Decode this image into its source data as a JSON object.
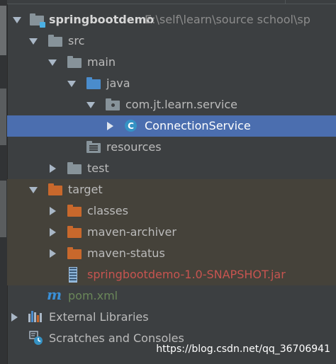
{
  "project": {
    "name": "springbootdemo",
    "path": "E:\\self\\learn\\source school\\sp"
  },
  "tree": {
    "src": "src",
    "main": "main",
    "java": "java",
    "package": "com.jt.learn.service",
    "class_file": "ConnectionService",
    "class_icon_letter": "C",
    "resources": "resources",
    "test": "test",
    "target": "target",
    "classes": "classes",
    "maven_archiver": "maven-archiver",
    "maven_status": "maven-status",
    "jar": "springbootdemo-1.0-SNAPSHOT.jar",
    "pom": "pom.xml",
    "pom_icon_letter": "m",
    "external_libraries": "External Libraries",
    "scratches": "Scratches and Consoles"
  },
  "watermark": "https://blog.csdn.net/qq_36706941",
  "colors": {
    "background": "#3c3f41",
    "selected_row": "#4b6eaf",
    "excluded_row": "#45423a",
    "jar_text": "#c75450",
    "pom_text": "#6a8759",
    "source_folder": "#4a8ccc",
    "excluded_folder": "#c8682c"
  },
  "icons": {
    "expand": "triangle-down-icon",
    "collapse": "triangle-right-icon",
    "folder": "folder-icon",
    "package": "package-icon",
    "class": "class-icon",
    "jar": "jar-icon",
    "maven": "maven-icon",
    "libraries": "libraries-icon",
    "scratches": "scratches-icon"
  }
}
